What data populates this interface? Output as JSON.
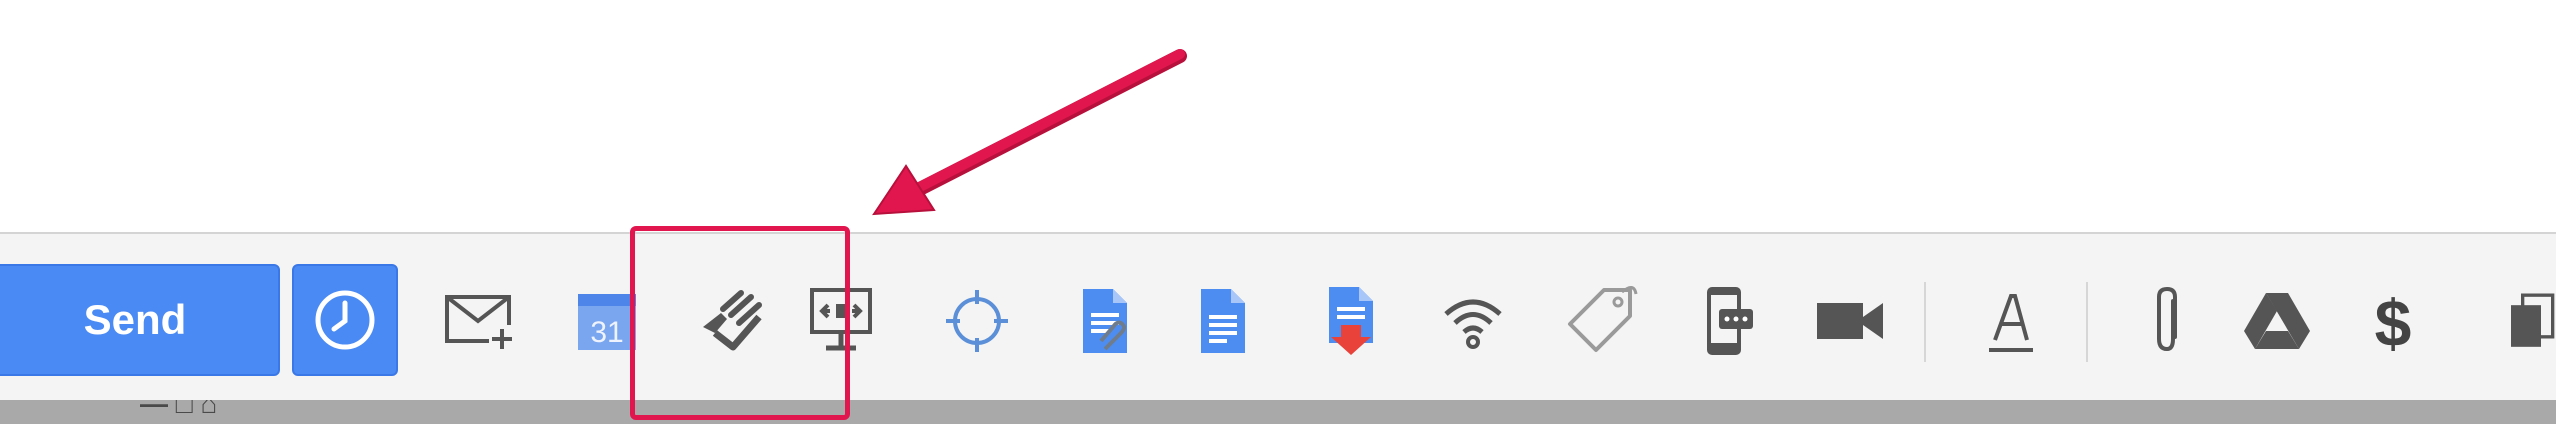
{
  "toolbar": {
    "send_label": "Send",
    "calendar_day": "31",
    "icons": [
      "schedule-clock-icon",
      "compose-mail-icon",
      "calendar-icon",
      "signature-tracking-icon",
      "screen-share-icon",
      "crosshair-target-icon",
      "doc-attach-icon",
      "google-doc-icon",
      "pdf-download-icon",
      "wifi-tracking-icon",
      "tag-icon",
      "mobile-sms-icon",
      "video-camera-icon",
      "text-format-icon",
      "paperclip-icon",
      "google-drive-icon",
      "dollar-icon",
      "copy-icon"
    ]
  },
  "annotation": {
    "box_color": "#e2164f",
    "arrow_color": "#e2164f"
  },
  "colors": {
    "accent": "#4a8af4",
    "toolbar_bg": "#f4f4f4"
  }
}
